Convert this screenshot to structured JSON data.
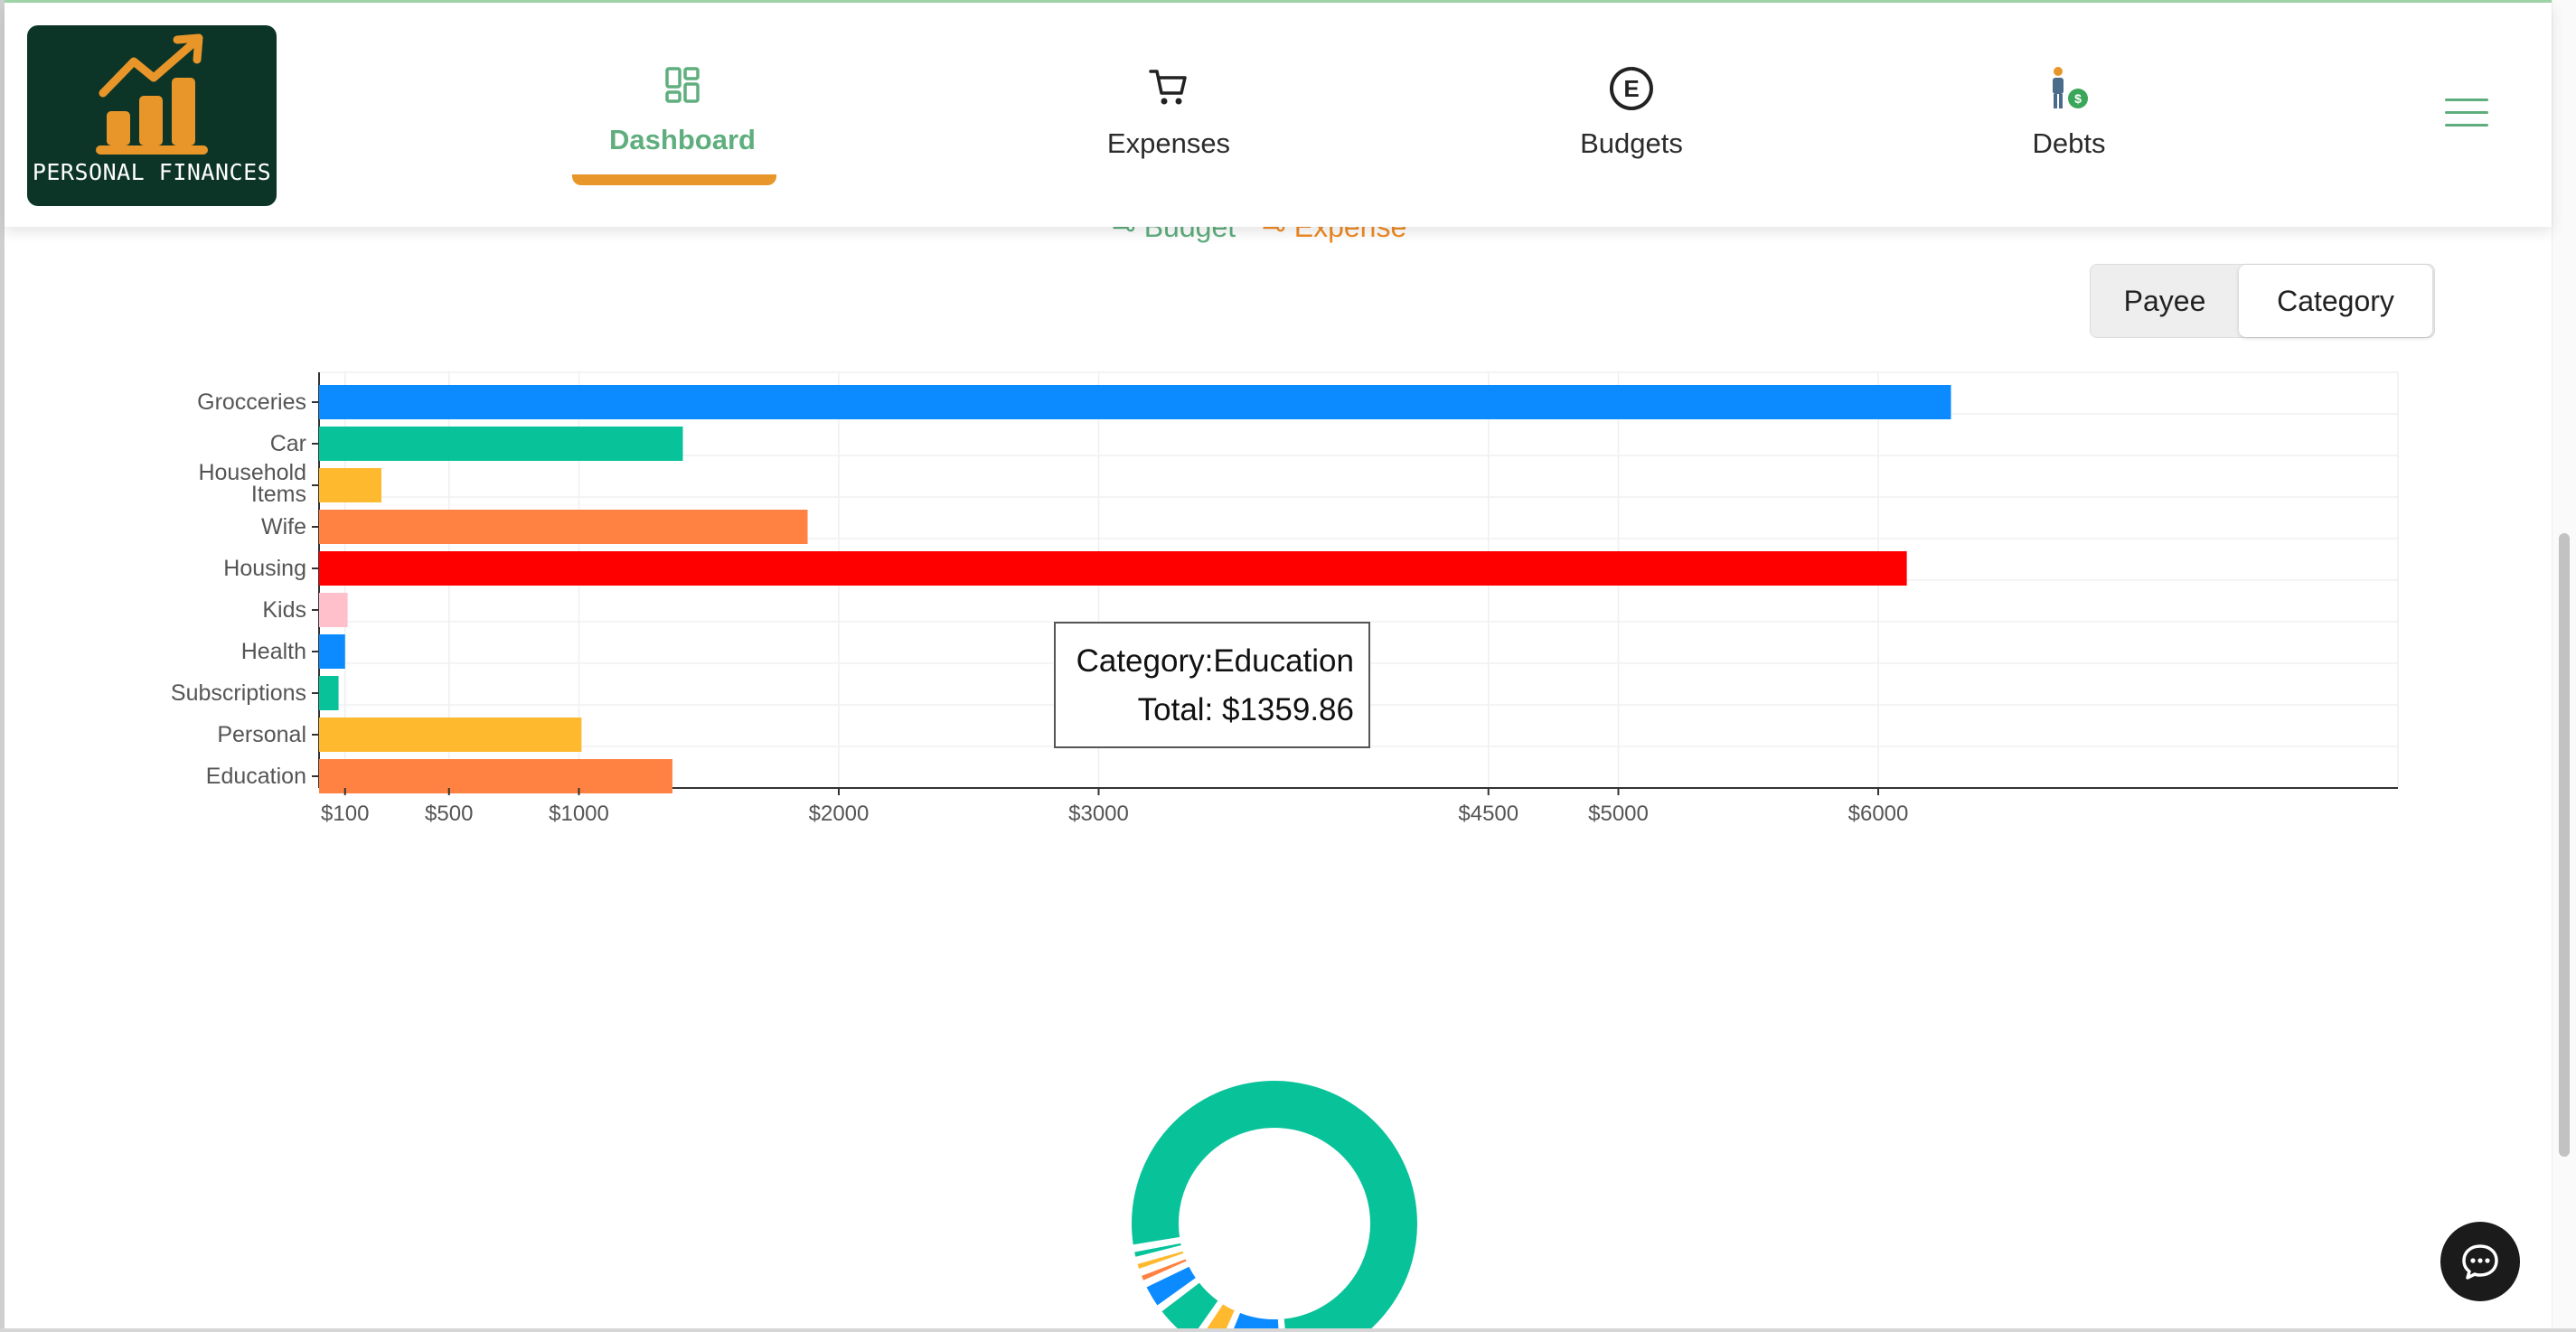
{
  "app": {
    "logo_text": "PERSONAL FINANCES"
  },
  "nav": {
    "items": [
      {
        "label": "Dashboard",
        "icon": "dashboard-grid-icon",
        "active": true
      },
      {
        "label": "Expenses",
        "icon": "shopping-cart-icon",
        "active": false
      },
      {
        "label": "Budgets",
        "icon": "euro-circle-icon",
        "active": false
      },
      {
        "label": "Debts",
        "icon": "person-money-icon",
        "active": false
      }
    ],
    "menu_icon": "hamburger-menu-icon"
  },
  "legend": {
    "budget_label": "Budget",
    "expense_label": "Expense"
  },
  "toggle": {
    "options": [
      "Payee",
      "Category"
    ],
    "selected": "Category"
  },
  "tooltip": {
    "line1": "Category:Education",
    "line2": "Total: $1359.86"
  },
  "colors": {
    "brand_dark": "#0d3527",
    "accent_green": "#5fae7e",
    "accent_orange": "#e8962a"
  },
  "chart_data": [
    {
      "type": "bar",
      "orientation": "horizontal",
      "categories": [
        "Grocceries",
        "Car",
        "Household Items",
        "Wife",
        "Housing",
        "Kids",
        "Health",
        "Subscriptions",
        "Personal",
        "Education"
      ],
      "values": [
        6280,
        1400,
        240,
        1880,
        6110,
        110,
        100,
        75,
        1010,
        1359.86
      ],
      "colors": [
        "#0b8bff",
        "#08c39a",
        "#ffb92e",
        "#ff8243",
        "#ff0000",
        "#ffc0cb",
        "#0b8bff",
        "#08c39a",
        "#ffb92e",
        "#ff8243"
      ],
      "x_ticks": [
        "$100",
        "$500",
        "$1000",
        "$2000",
        "$3000",
        "$4500",
        "$5000",
        "$6000"
      ],
      "x_tick_values": [
        100,
        500,
        1000,
        2000,
        3000,
        4500,
        5000,
        6000
      ],
      "xlim": [
        0,
        8000
      ],
      "grid": true
    },
    {
      "type": "pie",
      "variant": "donut",
      "values": [
        72,
        7,
        3,
        5,
        3,
        1.3,
        1.3,
        1.3
      ],
      "colors": [
        "#08c39a",
        "#0b8bff",
        "#ffb92e",
        "#08c39a",
        "#0b8bff",
        "#ff8243",
        "#ffb92e",
        "#08c39a"
      ]
    }
  ],
  "chat": {
    "icon": "chat-bubble-icon"
  }
}
